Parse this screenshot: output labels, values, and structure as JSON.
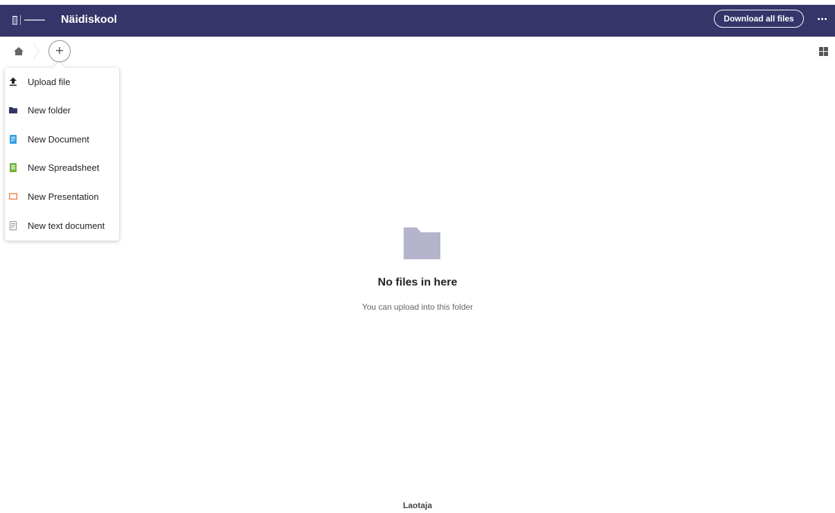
{
  "header": {
    "title": "Näidiskool",
    "download_label": "Download all files",
    "more_icon": "more-horizontal-icon",
    "background": "#35356a"
  },
  "toolbar": {
    "home_icon": "home-icon",
    "add_label": "+",
    "view_icon": "grid-view-icon"
  },
  "new_menu": {
    "items": [
      {
        "label": "Upload file",
        "icon": "upload-icon",
        "color": "#222222"
      },
      {
        "label": "New folder",
        "icon": "folder-icon",
        "color": "#35356a"
      },
      {
        "label": "New Document",
        "icon": "document-icon",
        "color": "#3aa0e6"
      },
      {
        "label": "New Spreadsheet",
        "icon": "spreadsheet-icon",
        "color": "#6fb23b"
      },
      {
        "label": "New Presentation",
        "icon": "presentation-icon",
        "color": "#ef7d3a"
      },
      {
        "label": "New text document",
        "icon": "text-document-icon",
        "color": "#8c8c8c"
      }
    ]
  },
  "empty_state": {
    "icon": "folder-icon",
    "title": "No files in here",
    "subtitle": "You can upload into this folder"
  },
  "footer": {
    "text": "Laotaja"
  }
}
